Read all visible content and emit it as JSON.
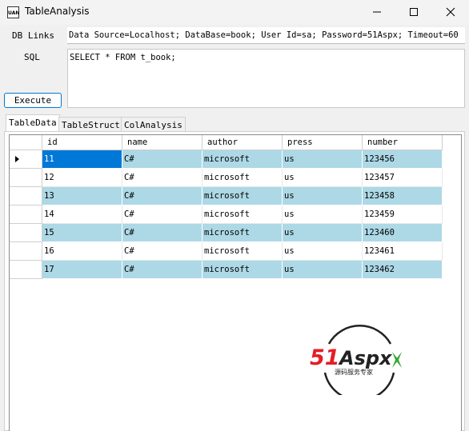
{
  "window": {
    "title": "TableAnalysis",
    "icon_text": "UAN"
  },
  "form": {
    "db_links_label": "DB Links",
    "db_links_value": "Data Source=Localhost; DataBase=book; User Id=sa; Password=51Aspx; Timeout=60",
    "sql_label": "SQL",
    "sql_value": "SELECT * FROM t_book;",
    "execute_label": "Execute"
  },
  "tabs": [
    {
      "label": "TableData",
      "active": true
    },
    {
      "label": "TableStruct",
      "active": false
    },
    {
      "label": "ColAnalysis",
      "active": false
    }
  ],
  "grid": {
    "columns": [
      "id",
      "name",
      "author",
      "press",
      "number"
    ],
    "rows": [
      [
        "11",
        "C#",
        "microsoft",
        "us",
        "123456"
      ],
      [
        "12",
        "C#",
        "microsoft",
        "us",
        "123457"
      ],
      [
        "13",
        "C#",
        "microsoft",
        "us",
        "123458"
      ],
      [
        "14",
        "C#",
        "microsoft",
        "us",
        "123459"
      ],
      [
        "15",
        "C#",
        "microsoft",
        "us",
        "123460"
      ],
      [
        "16",
        "C#",
        "microsoft",
        "us",
        "123461"
      ],
      [
        "17",
        "C#",
        "microsoft",
        "us",
        "123462"
      ]
    ],
    "current_row": 0,
    "alt_color": "#add8e6",
    "selection_color": "#0078d7"
  },
  "watermark": {
    "brand_51": "51",
    "brand_aspx": "Aspx",
    "tagline": "源码服务专家"
  }
}
